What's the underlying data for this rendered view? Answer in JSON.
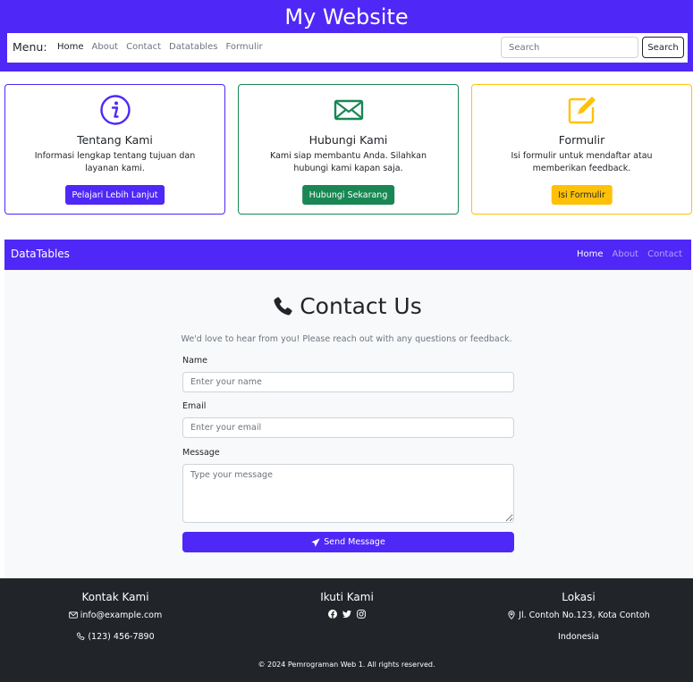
{
  "header": {
    "title": "My Website"
  },
  "nav": {
    "menu_label": "Menu:",
    "links": [
      "Home",
      "About",
      "Contact",
      "Datatables",
      "Formulir"
    ],
    "search_placeholder": "Search",
    "search_button": "Search"
  },
  "cards": [
    {
      "title": "Tentang Kami",
      "desc": "Informasi lengkap tentang tujuan dan layanan kami.",
      "button": "Pelajari Lebih Lanjut",
      "color": "#4f28f7",
      "icon": "info-circle-icon"
    },
    {
      "title": "Hubungi Kami",
      "desc": "Kami siap membantu Anda. Silahkan hubungi kami kapan saja.",
      "button": "Hubungi Sekarang",
      "color": "#198754",
      "icon": "envelope-icon"
    },
    {
      "title": "Formulir",
      "desc": "Isi formulir untuk mendaftar atau memberikan feedback.",
      "button": "Isi Formulir",
      "color": "#ffc107",
      "icon": "pencil-square-icon"
    }
  ],
  "dt_nav": {
    "brand": "DataTables",
    "links": [
      "Home",
      "About",
      "Contact"
    ]
  },
  "contact": {
    "title": "Contact Us",
    "subtitle": "We'd love to hear from you! Please reach out with any questions or feedback.",
    "name_label": "Name",
    "name_placeholder": "Enter your name",
    "email_label": "Email",
    "email_placeholder": "Enter your email",
    "message_label": "Message",
    "message_placeholder": "Type your message",
    "send_button": "Send Message"
  },
  "footer": {
    "kontak_title": "Kontak Kami",
    "email": "info@example.com",
    "phone": "(123) 456-7890",
    "ikuti_title": "Ikuti Kami",
    "social_icons": [
      "facebook-icon",
      "twitter-icon",
      "instagram-icon"
    ],
    "lokasi_title": "Lokasi",
    "address_line1": "Jl. Contoh No.123, Kota Contoh",
    "address_line2": "Indonesia",
    "copyright": "© 2024 Pemrograman Web 1. All rights reserved."
  },
  "colors": {
    "primary": "#4f28f7",
    "success": "#198754",
    "warning": "#ffc107",
    "dark": "#212529"
  }
}
